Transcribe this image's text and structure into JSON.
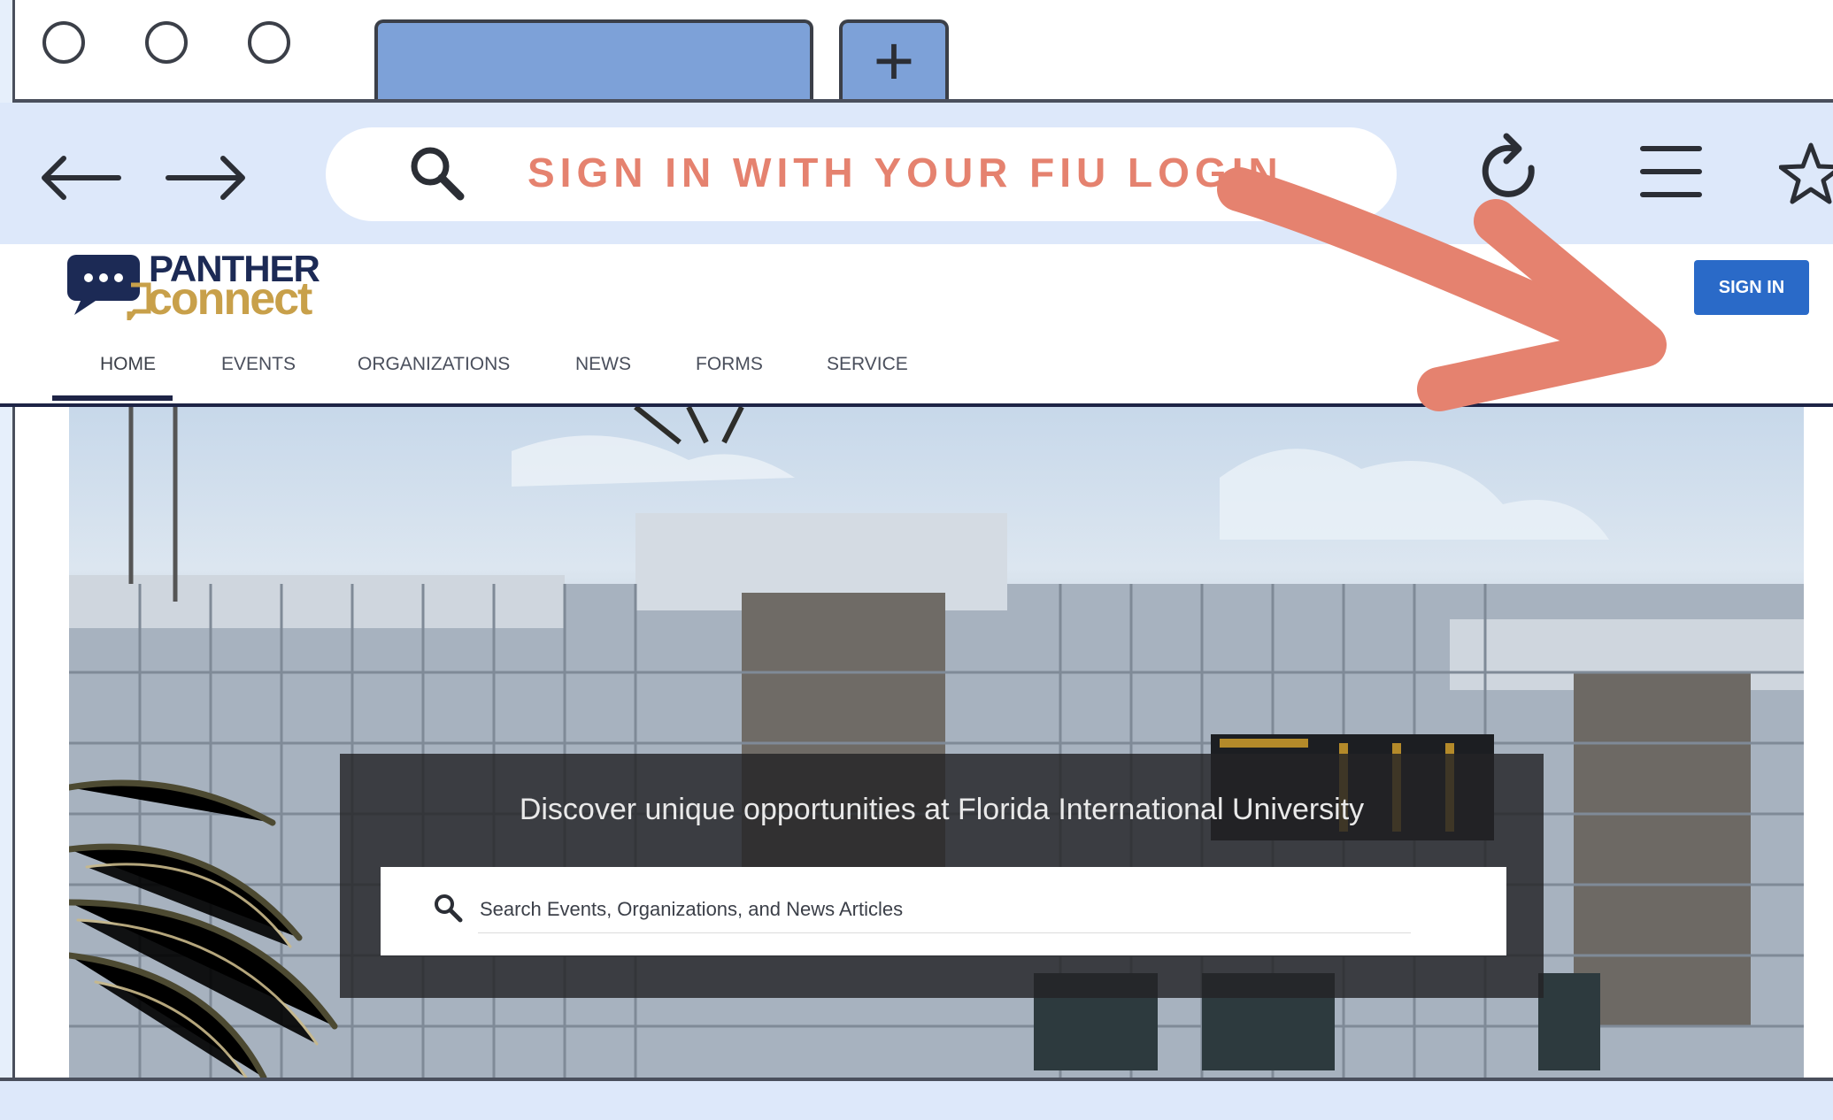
{
  "browser": {
    "window_buttons": [
      "circle",
      "circle",
      "circle"
    ],
    "new_tab_label": "+",
    "address_bar_text": "SIGN IN WITH YOUR FIU LOGIN",
    "icons": {
      "back": "arrow-left-icon",
      "forward": "arrow-right-icon",
      "search": "search-icon",
      "refresh": "refresh-icon",
      "menu": "hamburger-menu-icon",
      "bookmark": "star-icon"
    }
  },
  "site": {
    "logo_top": "PANTHER",
    "logo_bottom": "connect",
    "signin_label": "SIGN IN",
    "nav": [
      "HOME",
      "EVENTS",
      "ORGANIZATIONS",
      "NEWS",
      "FORMS",
      "SERVICE"
    ],
    "active_nav": "HOME"
  },
  "hero": {
    "headline": "Discover unique opportunities at Florida International University",
    "search_placeholder": "Search Events, Organizations, and News Articles"
  },
  "colors": {
    "annotation_arrow": "#e5826f",
    "tab_blue": "#7da1d8",
    "toolbar_blue": "#dde8fa",
    "signin_blue": "#2a6ac8",
    "brand_navy": "#1c2a55",
    "brand_gold": "#c8a04a"
  }
}
